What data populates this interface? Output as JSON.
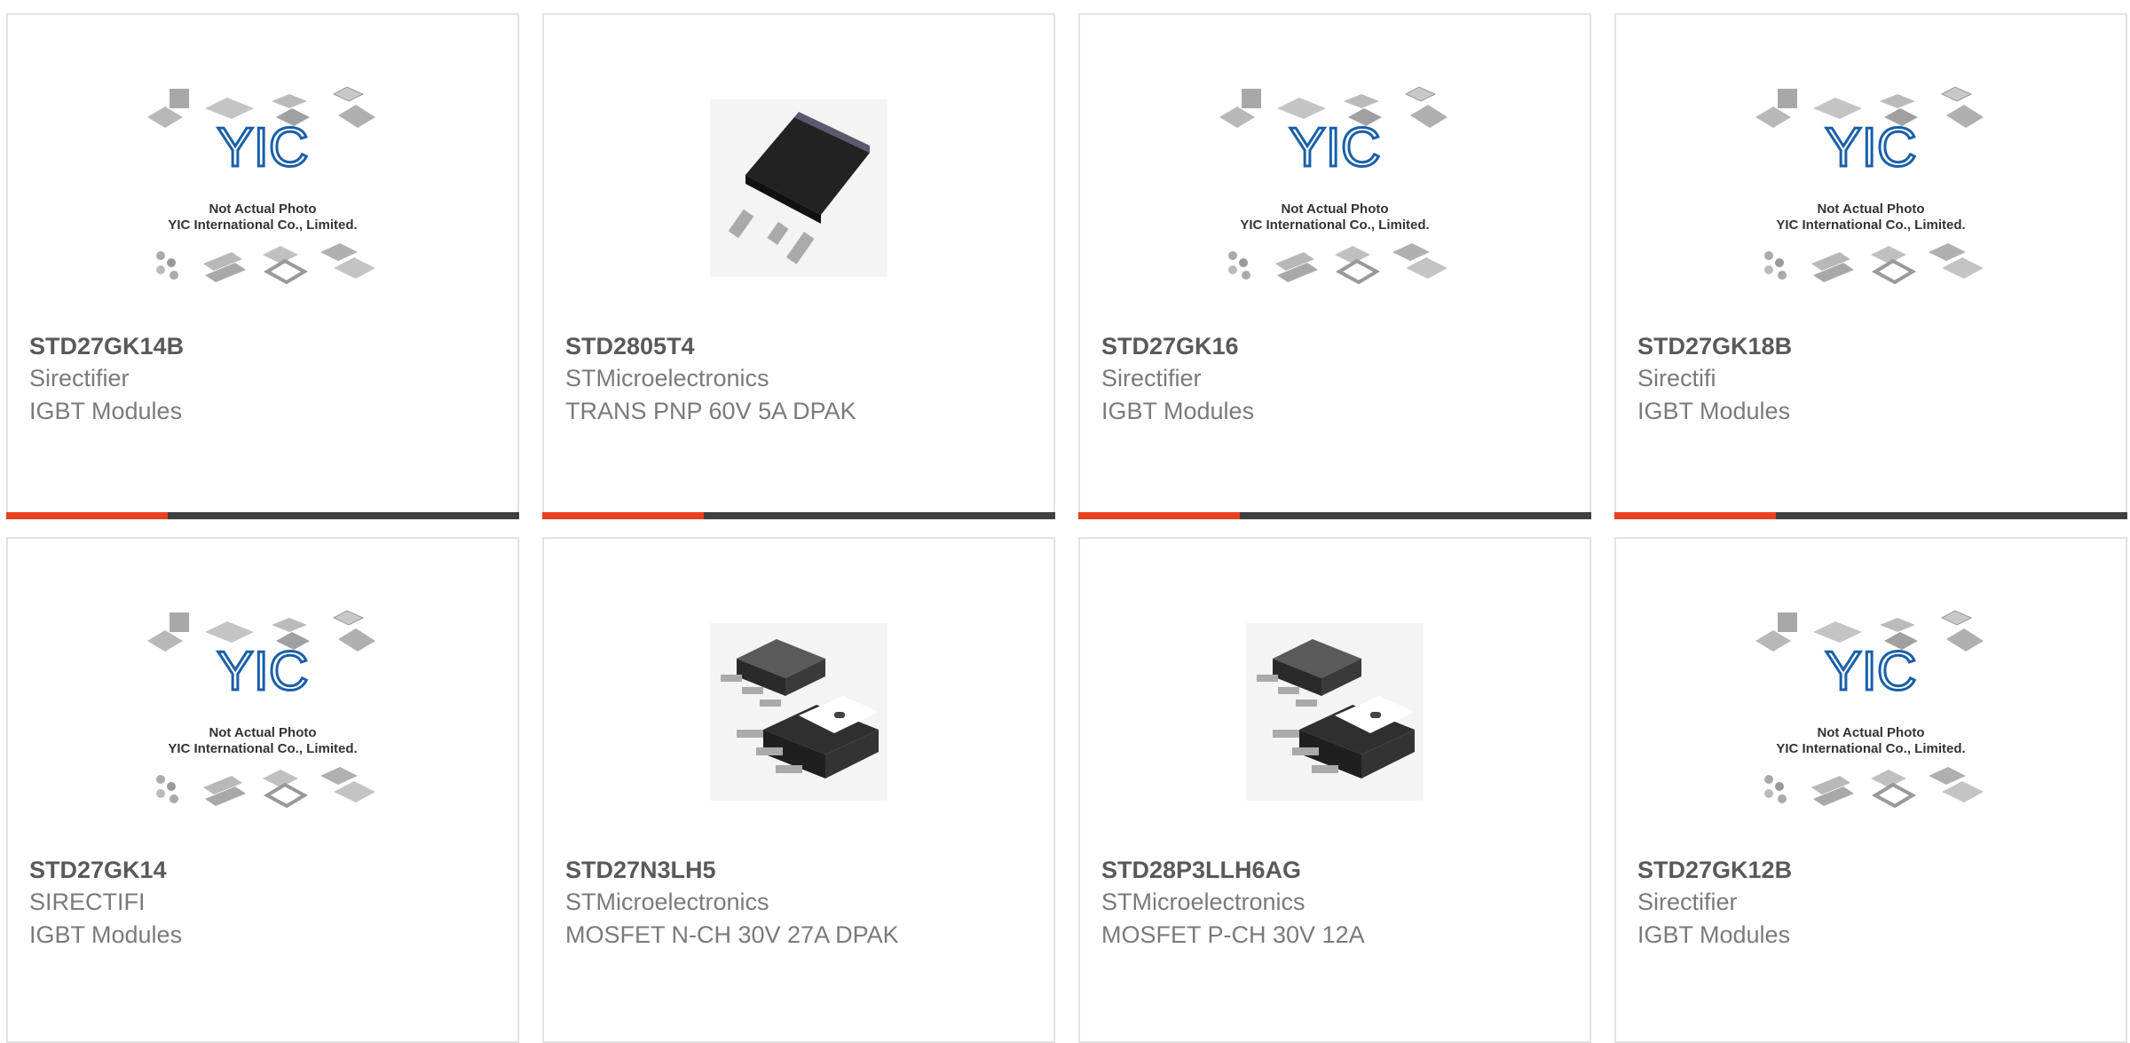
{
  "products": [
    {
      "part": "STD27GK14B",
      "manufacturer": "Sirectifier",
      "description": "IGBT Modules",
      "image": "placeholder"
    },
    {
      "part": "STD2805T4",
      "manufacturer": "STMicroelectronics",
      "description": "TRANS PNP 60V 5A DPAK",
      "image": "dpak"
    },
    {
      "part": "STD27GK16",
      "manufacturer": "Sirectifier",
      "description": "IGBT Modules",
      "image": "placeholder"
    },
    {
      "part": "STD27GK18B",
      "manufacturer": "Sirectifi",
      "description": "IGBT Modules",
      "image": "placeholder"
    },
    {
      "part": "STD27GK14",
      "manufacturer": "SIRECTIFI",
      "description": "IGBT Modules",
      "image": "placeholder"
    },
    {
      "part": "STD27N3LH5",
      "manufacturer": "STMicroelectronics",
      "description": "MOSFET N-CH 30V 27A DPAK",
      "image": "dpak-pair"
    },
    {
      "part": "STD28P3LLH6AG",
      "manufacturer": "STMicroelectronics",
      "description": "MOSFET P-CH 30V 12A",
      "image": "dpak-pair"
    },
    {
      "part": "STD27GK12B",
      "manufacturer": "Sirectifier",
      "description": "IGBT Modules",
      "image": "placeholder"
    }
  ],
  "placeholder": {
    "logo": "YIC",
    "line1": "Not Actual Photo",
    "line2": "YIC International Co., Limited."
  },
  "colors": {
    "accent": "#e8401c",
    "bar": "#404040",
    "border": "#e2e2e2",
    "logo": "#1a5fa8"
  }
}
